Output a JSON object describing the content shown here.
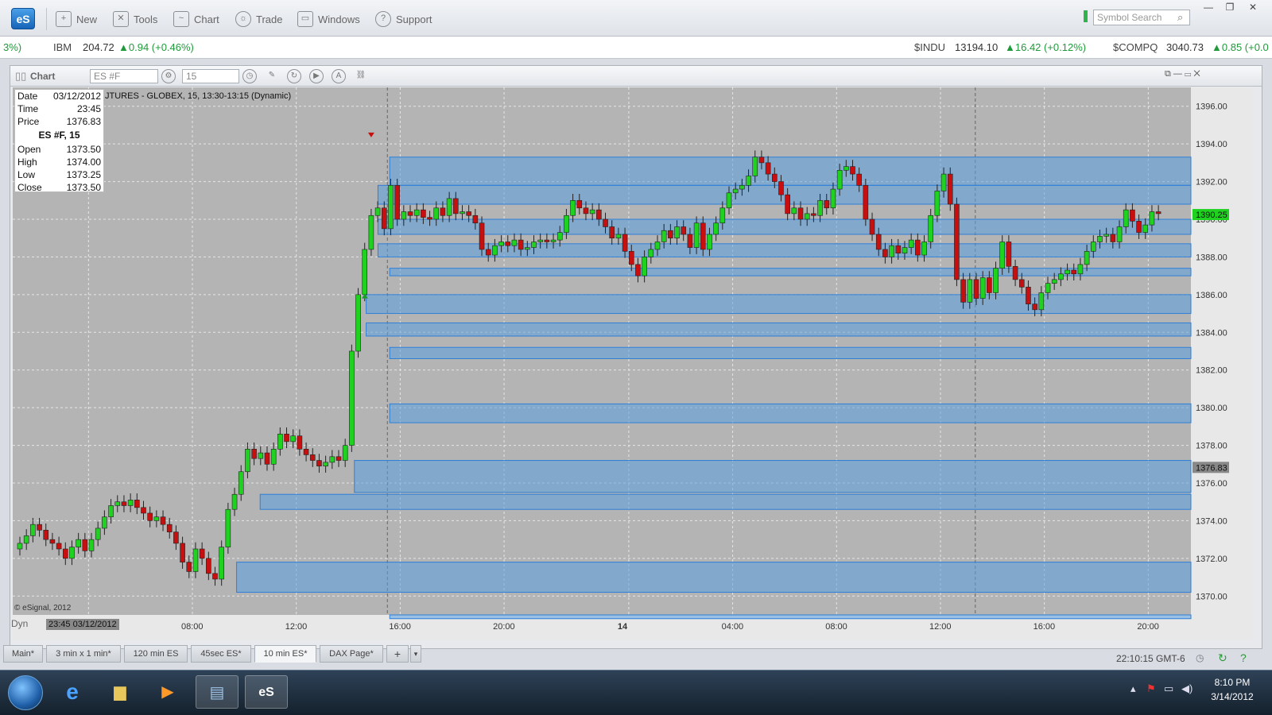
{
  "toolbar": {
    "new": "New",
    "tools": "Tools",
    "chart": "Chart",
    "trade": "Trade",
    "windows": "Windows",
    "support": "Support",
    "search_placeholder": "Symbol Search",
    "logo": "eS"
  },
  "ticker": {
    "lead": "3%)",
    "ibm_sym": "IBM",
    "ibm_val": "204.72",
    "ibm_chg": "▲0.94 (+0.46%)",
    "indu_sym": "$INDU",
    "indu_val": "13194.10",
    "indu_chg": "▲16.42 (+0.12%)",
    "comp_sym": "$COMPQ",
    "comp_val": "3040.73",
    "comp_chg": "▲0.85 (+0.0"
  },
  "chart_window": {
    "title": "Chart",
    "symbol": "ES #F",
    "interval": "15",
    "legend": "JTURES - GLOBEX, 15, 13:30-13:15 (Dynamic)",
    "copyright": "© eSignal, 2012",
    "dyn": "Dyn",
    "cursor_date": "23:45 03/12/2012"
  },
  "databox": {
    "date_l": "Date",
    "date_v": "03/12/2012",
    "time_l": "Time",
    "time_v": "23:45",
    "price_l": "Price",
    "price_v": "1376.83",
    "title": "ES #F, 15",
    "open_l": "Open",
    "open_v": "1373.50",
    "high_l": "High",
    "high_v": "1374.00",
    "low_l": "Low",
    "low_v": "1373.25",
    "close_l": "Close",
    "close_v": "1373.50"
  },
  "colors": {
    "up": "#1fd21f",
    "down": "#c80f0f",
    "bg": "#b4b4b4",
    "band": "#5a9fe0"
  },
  "chart_data": {
    "type": "candlestick",
    "ylim": [
      1369,
      1397
    ],
    "y_ticks": [
      "1396.00",
      "1394.00",
      "1392.00",
      "1390.00",
      "1388.00",
      "1386.00",
      "1384.00",
      "1382.00",
      "1380.00",
      "1378.00",
      "1376.00",
      "1374.00",
      "1372.00",
      "1370.00"
    ],
    "x_ticks": [
      "04:00",
      "08:00",
      "12:00",
      "16:00",
      "20:00",
      "14",
      "04:00",
      "08:00",
      "12:00",
      "16:00",
      "20:00"
    ],
    "last_price": "1390.25",
    "cursor_price": "1376.83",
    "closes": [
      1372.8,
      1373.2,
      1373.8,
      1373.5,
      1373.0,
      1372.8,
      1372.5,
      1372.0,
      1372.6,
      1373.0,
      1372.4,
      1373.0,
      1373.6,
      1374.2,
      1374.8,
      1375.0,
      1374.8,
      1375.1,
      1374.7,
      1374.4,
      1374.0,
      1374.2,
      1373.8,
      1373.4,
      1372.8,
      1371.8,
      1371.3,
      1372.5,
      1372.0,
      1371.2,
      1370.9,
      1372.6,
      1374.6,
      1375.4,
      1376.6,
      1377.8,
      1377.3,
      1377.6,
      1377.0,
      1377.8,
      1378.6,
      1378.2,
      1378.5,
      1377.8,
      1377.5,
      1377.2,
      1376.9,
      1377.1,
      1377.4,
      1377.2,
      1378.0,
      1383.0,
      1386.0,
      1388.4,
      1390.2,
      1390.6,
      1389.5,
      1391.8,
      1390.0,
      1390.4,
      1390.2,
      1390.5,
      1390.1,
      1390.0,
      1390.6,
      1390.2,
      1391.1,
      1390.3,
      1390.4,
      1390.2,
      1389.8,
      1388.4,
      1388.1,
      1388.6,
      1388.8,
      1388.6,
      1388.9,
      1388.4,
      1388.5,
      1388.8,
      1388.9,
      1388.8,
      1388.9,
      1389.3,
      1390.2,
      1391.0,
      1390.6,
      1390.3,
      1390.5,
      1390.0,
      1389.6,
      1389.0,
      1389.2,
      1388.3,
      1387.6,
      1387.0,
      1388.0,
      1388.4,
      1388.8,
      1389.4,
      1389.0,
      1389.6,
      1389.2,
      1388.5,
      1389.8,
      1388.4,
      1389.2,
      1389.8,
      1390.6,
      1391.4,
      1391.6,
      1391.8,
      1392.3,
      1393.3,
      1393.0,
      1392.4,
      1392.0,
      1391.3,
      1390.3,
      1390.6,
      1390.0,
      1390.3,
      1390.2,
      1391.0,
      1390.6,
      1391.6,
      1392.6,
      1392.8,
      1392.4,
      1391.8,
      1390.0,
      1389.2,
      1388.4,
      1388.0,
      1388.6,
      1388.2,
      1388.5,
      1388.9,
      1388.1,
      1388.8,
      1390.2,
      1391.5,
      1392.4,
      1390.8,
      1386.8,
      1385.6,
      1386.8,
      1385.8,
      1386.9,
      1386.1,
      1387.4,
      1388.8,
      1387.5,
      1386.8,
      1386.4,
      1385.5,
      1385.2,
      1386.1,
      1386.6,
      1386.8,
      1387.1,
      1387.3,
      1387.1,
      1387.6,
      1388.3,
      1388.8,
      1389.1,
      1389.2,
      1388.8,
      1389.6,
      1390.5,
      1389.9,
      1389.3,
      1389.7,
      1390.4,
      1390.3
    ]
  }
}
